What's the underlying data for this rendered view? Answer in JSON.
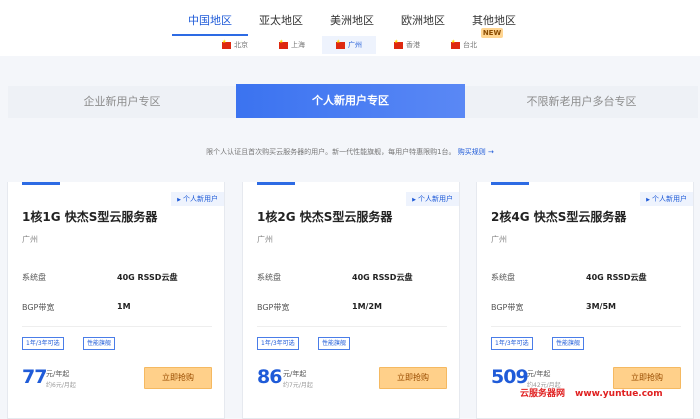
{
  "region_tabs": [
    {
      "label": "中国地区",
      "active": true
    },
    {
      "label": "亚太地区",
      "active": false
    },
    {
      "label": "美洲地区",
      "active": false
    },
    {
      "label": "欧洲地区",
      "active": false
    },
    {
      "label": "其他地区",
      "active": false
    }
  ],
  "new_badge": "NEW",
  "city_tabs": [
    {
      "label": "北京",
      "active": false
    },
    {
      "label": "上海",
      "active": false
    },
    {
      "label": "广州",
      "active": true
    },
    {
      "label": "香港",
      "active": false
    },
    {
      "label": "台北",
      "active": false
    }
  ],
  "user_tabs": [
    {
      "label": "企业新用户专区",
      "active": false
    },
    {
      "label": "个人新用户专区",
      "active": true
    },
    {
      "label": "不限新老用户多台专区",
      "active": false
    }
  ],
  "notice": {
    "text": "限个人认证且首次购买云服务器的用户。新一代性能旗舰，每用户特惠限购1台。",
    "link": "购买规则 →"
  },
  "cards": [
    {
      "badge": "个人新用户",
      "title": "1核1G 快杰S型云服务器",
      "location": "广州",
      "specs": [
        {
          "label": "系统盘",
          "value": "40G RSSD云盘"
        },
        {
          "label": "BGP带宽",
          "value": "1M"
        }
      ],
      "tags": [
        "1年/3年可选",
        "性能旗舰"
      ],
      "price": "77",
      "price_unit": "元/年起",
      "price_sub": "约6元/月起",
      "buy_label": "立即抢购"
    },
    {
      "badge": "个人新用户",
      "title": "1核2G 快杰S型云服务器",
      "location": "广州",
      "specs": [
        {
          "label": "系统盘",
          "value": "40G RSSD云盘"
        },
        {
          "label": "BGP带宽",
          "value": "1M/2M"
        }
      ],
      "tags": [
        "1年/3年可选",
        "性能旗舰"
      ],
      "price": "86",
      "price_unit": "元/年起",
      "price_sub": "约7元/月起",
      "buy_label": "立即抢购"
    },
    {
      "badge": "个人新用户",
      "title": "2核4G 快杰S型云服务器",
      "location": "广州",
      "specs": [
        {
          "label": "系统盘",
          "value": "40G RSSD云盘"
        },
        {
          "label": "BGP带宽",
          "value": "3M/5M"
        }
      ],
      "tags": [
        "1年/3年可选",
        "性能旗舰"
      ],
      "price": "509",
      "price_unit": "元/年起",
      "price_sub": "约42元/月起",
      "buy_label": "立即抢购"
    }
  ],
  "watermark": {
    "site_name": "云服务器网",
    "url": "www.yuntue.com"
  },
  "colors": {
    "accent": "#2d6be4",
    "buy_button": "#ffd08a",
    "new_badge": "#ffd591"
  }
}
